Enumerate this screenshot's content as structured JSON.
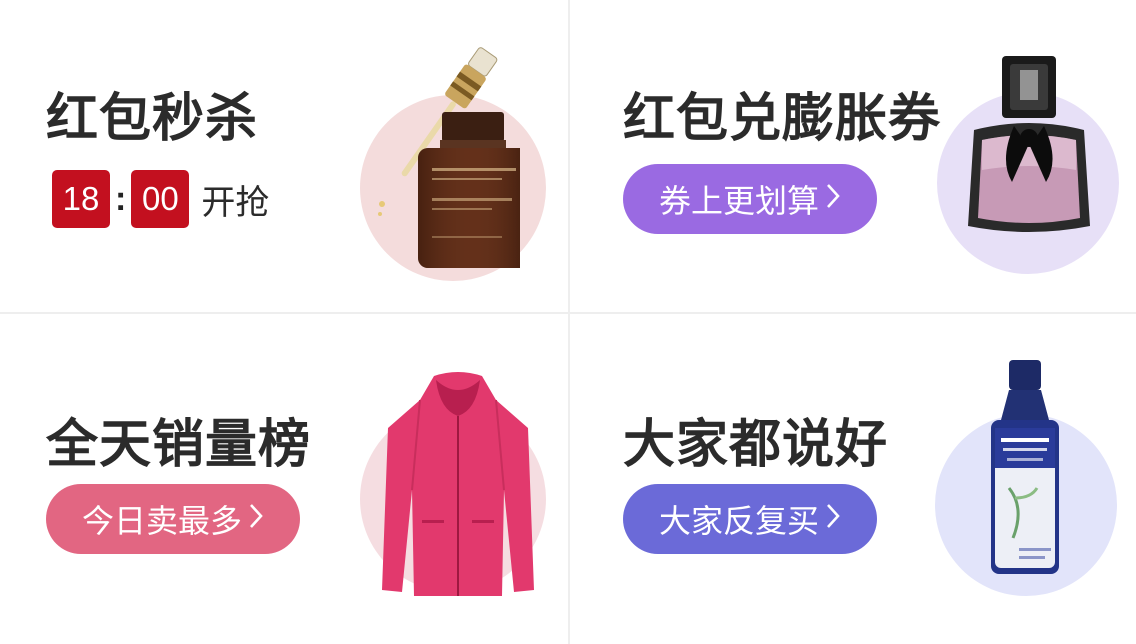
{
  "cards": [
    {
      "title": "红包秒杀",
      "countdown": {
        "hours": "18",
        "minutes": "00",
        "label": "开抢"
      }
    },
    {
      "title": "红包兑膨胀券",
      "button": {
        "label": "券上更划算",
        "color": "#9a6ae2"
      }
    },
    {
      "title": "全天销量榜",
      "button": {
        "label": "今日卖最多",
        "color": "#e26682"
      }
    },
    {
      "title": "大家都说好",
      "button": {
        "label": "大家反复买",
        "color": "#6b6ad8"
      }
    }
  ],
  "colors": {
    "countdown_bg": "#c3101f",
    "circle_pink": "#f4dcdc",
    "circle_lavender": "#e7e0f7",
    "circle_rose": "#f5dde1",
    "circle_blue": "#e2e4fa"
  },
  "products": [
    "serum-bottle",
    "perfume-bottle",
    "pink-jacket",
    "shampoo-bottle"
  ],
  "icons": [
    "chevron-right-icon"
  ]
}
